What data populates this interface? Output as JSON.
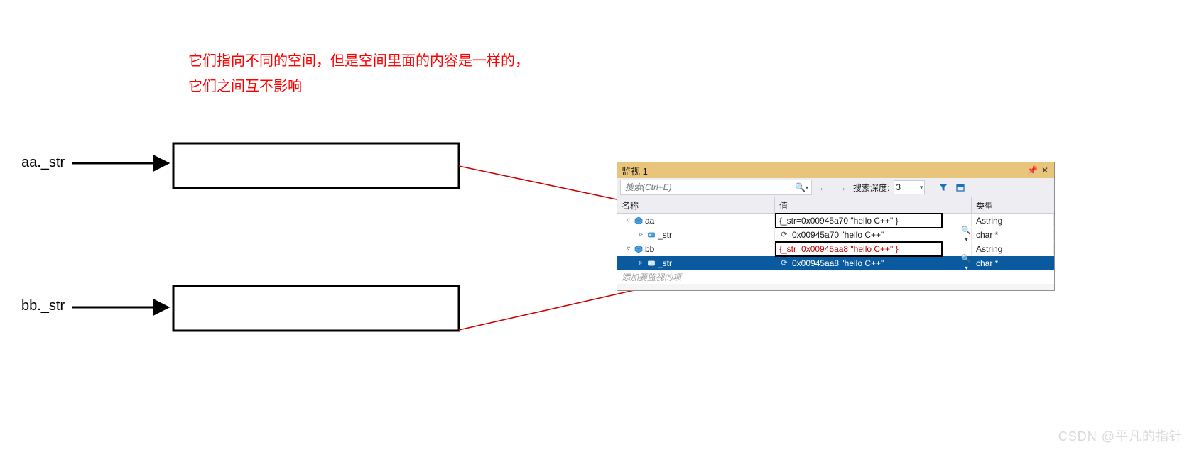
{
  "annotation": {
    "line1": "它们指向不同的空间，但是空间里面的内容是一样的，",
    "line2": "它们之间互不影响"
  },
  "pointers": {
    "aa_label": "aa._str",
    "bb_label": "bb._str"
  },
  "watch": {
    "title": "监视 1",
    "search_placeholder": "搜索(Ctrl+E)",
    "depth_label": "搜索深度:",
    "depth_value": "3",
    "headers": {
      "name": "名称",
      "value": "值",
      "type": "类型"
    },
    "rows": [
      {
        "depth": 0,
        "twist": "▿",
        "icon": "obj",
        "name": "aa",
        "value": "{_str=0x00945a70 \"hello C++\" }",
        "type": "Astring",
        "boxed": true,
        "red": false,
        "mag": false,
        "selected": false
      },
      {
        "depth": 1,
        "twist": "▹",
        "icon": "fld",
        "name": "_str",
        "value": "0x00945a70 \"hello C++\"",
        "type": "char *",
        "boxed": false,
        "red": false,
        "mag": true,
        "selected": false
      },
      {
        "depth": 0,
        "twist": "▿",
        "icon": "obj",
        "name": "bb",
        "value": "{_str=0x00945aa8 \"hello C++\" }",
        "type": "Astring",
        "boxed": true,
        "red": true,
        "mag": false,
        "selected": false
      },
      {
        "depth": 1,
        "twist": "▹",
        "icon": "fld",
        "name": "_str",
        "value": "0x00945aa8 \"hello C++\"",
        "type": "char *",
        "boxed": false,
        "red": false,
        "mag": true,
        "selected": true
      }
    ],
    "add_item": "添加要监视的项"
  },
  "watermark": "CSDN @平凡的指针"
}
